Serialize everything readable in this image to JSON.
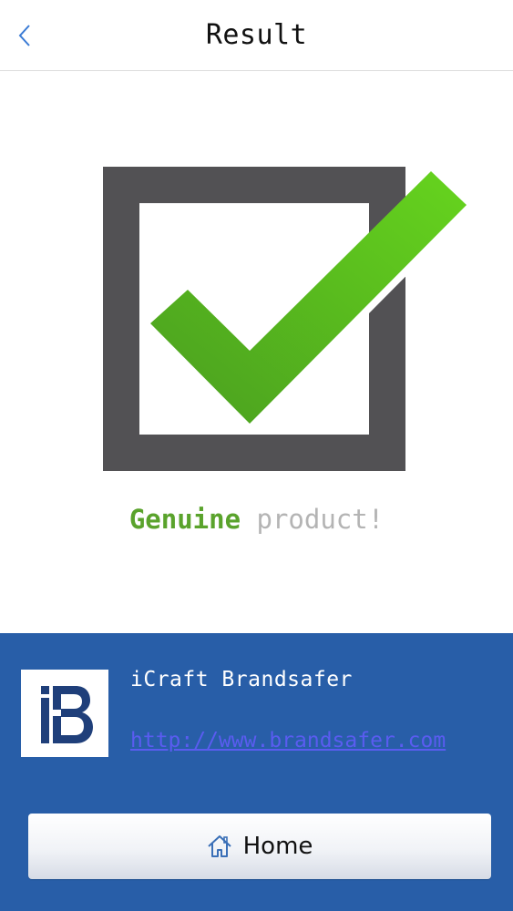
{
  "header": {
    "title": "Result",
    "back_icon": "chevron-left-icon"
  },
  "result": {
    "icon": "checkbox-checked-icon",
    "status_word": "Genuine",
    "status_rest": "product!",
    "status_color": "#5aa32c"
  },
  "brand": {
    "name": "iCraft Brandsafer",
    "url": "http://www.brandsafer.com",
    "logo": "brandsafer-logo",
    "panel_color": "#285ea8"
  },
  "home_button": {
    "label": "Home",
    "icon": "home-icon"
  }
}
